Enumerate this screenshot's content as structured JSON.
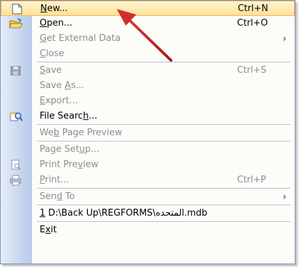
{
  "menu": {
    "items": [
      {
        "label_prefix": "",
        "mnemonic": "N",
        "label_suffix": "ew...",
        "shortcut": "Ctrl+N",
        "icon": "new-document-icon"
      },
      {
        "label_prefix": "",
        "mnemonic": "O",
        "label_suffix": "pen...",
        "shortcut": "Ctrl+O",
        "icon": "open-folder-icon"
      },
      {
        "label_prefix": "",
        "mnemonic": "G",
        "label_suffix": "et External Data",
        "shortcut": "",
        "icon": ""
      },
      {
        "label_prefix": "",
        "mnemonic": "C",
        "label_suffix": "lose",
        "shortcut": "",
        "icon": ""
      },
      {
        "label_prefix": "",
        "mnemonic": "S",
        "label_suffix": "ave",
        "shortcut": "Ctrl+S",
        "icon": "save-disk-icon"
      },
      {
        "label_prefix": "Save ",
        "mnemonic": "A",
        "label_suffix": "s...",
        "shortcut": "",
        "icon": ""
      },
      {
        "label_prefix": "",
        "mnemonic": "E",
        "label_suffix": "xport...",
        "shortcut": "",
        "icon": ""
      },
      {
        "label_prefix": "File Searc",
        "mnemonic": "h",
        "label_suffix": "...",
        "shortcut": "",
        "icon": "file-search-icon"
      },
      {
        "label_prefix": "We",
        "mnemonic": "b",
        "label_suffix": " Page Preview",
        "shortcut": "",
        "icon": ""
      },
      {
        "label_prefix": "Page Set",
        "mnemonic": "u",
        "label_suffix": "p...",
        "shortcut": "",
        "icon": ""
      },
      {
        "label_prefix": "Print Pre",
        "mnemonic": "v",
        "label_suffix": "iew",
        "shortcut": "",
        "icon": "print-preview-icon"
      },
      {
        "label_prefix": "",
        "mnemonic": "P",
        "label_suffix": "rint...",
        "shortcut": "Ctrl+P",
        "icon": "printer-icon"
      },
      {
        "label_prefix": "Sen",
        "mnemonic": "d",
        "label_suffix": " To",
        "shortcut": "",
        "icon": ""
      },
      {
        "label_prefix": "",
        "mnemonic": "1",
        "label_suffix": " D:\\Back Up\\REGFORMS\\المتحده.mdb",
        "shortcut": "",
        "icon": ""
      },
      {
        "label_prefix": "E",
        "mnemonic": "x",
        "label_suffix": "it",
        "shortcut": "",
        "icon": ""
      }
    ]
  },
  "colors": {
    "highlight": "#fde19a",
    "annotation_arrow": "#c0392b",
    "disabled_text": "#8d8d8d"
  }
}
